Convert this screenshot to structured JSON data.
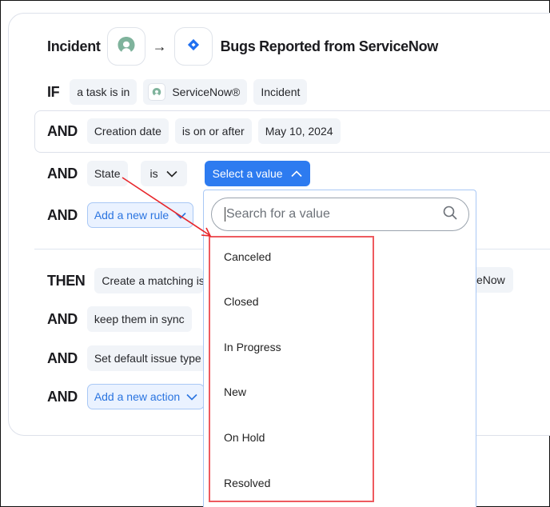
{
  "header": {
    "source_name": "Incident",
    "source_icon": "servicenow-logo-icon",
    "arrow": "→",
    "target_icon": "jira-logo-icon",
    "target_name": "Bugs Reported from ServiceNow"
  },
  "conditions": {
    "if_row": {
      "keyword": "IF",
      "chips": [
        "a task is in",
        "ServiceNow®",
        "Incident"
      ]
    },
    "and_rows": [
      {
        "keyword": "AND",
        "field": "Creation date",
        "operator": "is on or after",
        "value": "May 10, 2024"
      },
      {
        "keyword": "AND",
        "field": "State",
        "operator": "is",
        "value": "Select a value"
      }
    ],
    "add_rule": {
      "keyword": "AND",
      "label": "Add a new rule"
    }
  },
  "actions": {
    "then_row": {
      "keyword": "THEN",
      "label_left": "Create a matching is",
      "label_right": "eNow"
    },
    "sync_row": {
      "keyword": "AND",
      "label": "keep them in sync"
    },
    "issue_type_row": {
      "keyword": "AND",
      "label": "Set default issue type"
    },
    "add_action": {
      "keyword": "AND",
      "label": "Add a new action"
    }
  },
  "dropdown": {
    "search_placeholder": "Search for a value",
    "search_value": "",
    "options": [
      "Canceled",
      "Closed",
      "In Progress",
      "New",
      "On Hold",
      "Resolved"
    ]
  },
  "colors": {
    "primary": "#2d7bf0",
    "chip_bg": "#f1f4f8",
    "outline_chip_bg": "#eaf2ff",
    "servicenow_green": "#7fb39c",
    "jira_blue": "#1f6ff0",
    "annotation_red": "#ee5a5f"
  }
}
